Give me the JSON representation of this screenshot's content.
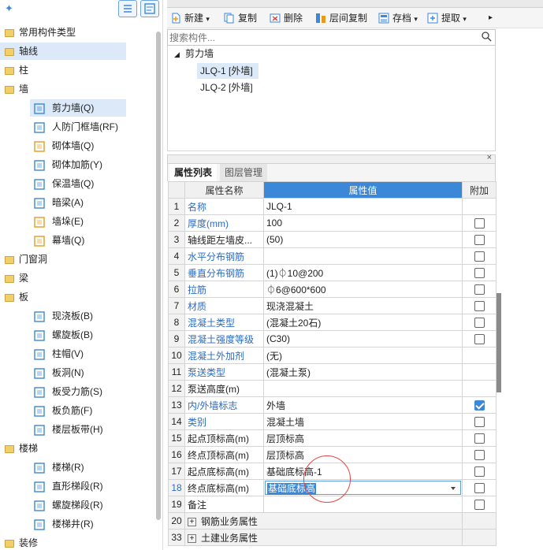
{
  "tree": {
    "items": [
      {
        "label": "常用构件类型",
        "level": 0,
        "icon": "folder-icon"
      },
      {
        "label": "轴线",
        "level": 0,
        "icon": "folder-icon",
        "selected": true
      },
      {
        "label": "柱",
        "level": 0,
        "icon": "folder-icon"
      },
      {
        "label": "墙",
        "level": 0,
        "icon": "folder-icon"
      },
      {
        "label": "剪力墙(Q)",
        "level": 1,
        "icon": "shear-wall-icon",
        "selected": true
      },
      {
        "label": "人防门框墙(RF)",
        "level": 1,
        "icon": "civil-defense-door-wall-icon"
      },
      {
        "label": "砌体墙(Q)",
        "level": 1,
        "icon": "masonry-wall-icon"
      },
      {
        "label": "砌体加筋(Y)",
        "level": 1,
        "icon": "masonry-rebar-icon"
      },
      {
        "label": "保温墙(Q)",
        "level": 1,
        "icon": "insulation-wall-icon"
      },
      {
        "label": "暗梁(A)",
        "level": 1,
        "icon": "hidden-beam-icon"
      },
      {
        "label": "墙垛(E)",
        "level": 1,
        "icon": "wall-pier-icon"
      },
      {
        "label": "幕墙(Q)",
        "level": 1,
        "icon": "curtain-wall-icon"
      },
      {
        "label": "门窗洞",
        "level": 0,
        "icon": "folder-icon"
      },
      {
        "label": "梁",
        "level": 0,
        "icon": "folder-icon"
      },
      {
        "label": "板",
        "level": 0,
        "icon": "folder-icon"
      },
      {
        "label": "现浇板(B)",
        "level": 1,
        "icon": "cast-slab-icon"
      },
      {
        "label": "螺旋板(B)",
        "level": 1,
        "icon": "spiral-slab-icon"
      },
      {
        "label": "柱帽(V)",
        "level": 1,
        "icon": "column-cap-icon"
      },
      {
        "label": "板洞(N)",
        "level": 1,
        "icon": "slab-hole-icon"
      },
      {
        "label": "板受力筋(S)",
        "level": 1,
        "icon": "slab-main-rebar-icon"
      },
      {
        "label": "板负筋(F)",
        "level": 1,
        "icon": "slab-negative-rebar-icon"
      },
      {
        "label": "楼层板带(H)",
        "level": 1,
        "icon": "floor-strip-icon"
      },
      {
        "label": "楼梯",
        "level": 0,
        "icon": "folder-icon"
      },
      {
        "label": "楼梯(R)",
        "level": 1,
        "icon": "stair-icon"
      },
      {
        "label": "直形梯段(R)",
        "level": 1,
        "icon": "straight-flight-icon"
      },
      {
        "label": "螺旋梯段(R)",
        "level": 1,
        "icon": "spiral-flight-icon"
      },
      {
        "label": "楼梯井(R)",
        "level": 1,
        "icon": "stairwell-icon"
      },
      {
        "label": "装修",
        "level": 0,
        "icon": "folder-icon"
      }
    ]
  },
  "toolbar": {
    "new_label": "新建",
    "copy_label": "复制",
    "delete_label": "删除",
    "layer_copy_label": "层间复制",
    "save_label": "存档",
    "extract_label": "提取"
  },
  "search": {
    "placeholder": "搜索构件..."
  },
  "components": {
    "group": "剪力墙",
    "items": [
      {
        "label": "JLQ-1 [外墙]",
        "selected": true
      },
      {
        "label": "JLQ-2 [外墙]",
        "selected": false
      }
    ]
  },
  "props": {
    "tabs": [
      "属性列表",
      "图层管理"
    ],
    "headers": {
      "name": "属性名称",
      "value": "属性值",
      "extra": "附加"
    },
    "rows": [
      {
        "no": "1",
        "name": "名称",
        "value": "JLQ-1",
        "blue": true,
        "check": null
      },
      {
        "no": "2",
        "name": "厚度(mm)",
        "value": "100",
        "blue": true,
        "check": false
      },
      {
        "no": "3",
        "name": "轴线距左墙皮...",
        "value": "(50)",
        "blue": false,
        "check": false
      },
      {
        "no": "4",
        "name": "水平分布钢筋",
        "value": "",
        "blue": true,
        "check": false
      },
      {
        "no": "5",
        "name": "垂直分布钢筋",
        "value": "(1)⏀10@200",
        "blue": true,
        "check": false
      },
      {
        "no": "6",
        "name": "拉筋",
        "value": "⏀6@600*600",
        "blue": true,
        "check": false
      },
      {
        "no": "7",
        "name": "材质",
        "value": "现浇混凝土",
        "blue": true,
        "check": false
      },
      {
        "no": "8",
        "name": "混凝土类型",
        "value": "(混凝土20石)",
        "blue": true,
        "check": false
      },
      {
        "no": "9",
        "name": "混凝土强度等级",
        "value": "(C30)",
        "blue": true,
        "check": false
      },
      {
        "no": "10",
        "name": "混凝土外加剂",
        "value": "(无)",
        "blue": true,
        "check": null
      },
      {
        "no": "11",
        "name": "泵送类型",
        "value": "(混凝土泵)",
        "blue": true,
        "check": null
      },
      {
        "no": "12",
        "name": "泵送高度(m)",
        "value": "",
        "blue": false,
        "check": null
      },
      {
        "no": "13",
        "name": "内/外墙标志",
        "value": "外墙",
        "blue": true,
        "check": true
      },
      {
        "no": "14",
        "name": "类别",
        "value": "混凝土墙",
        "blue": true,
        "check": false
      },
      {
        "no": "15",
        "name": "起点顶标高(m)",
        "value": "层顶标高",
        "blue": false,
        "check": false
      },
      {
        "no": "16",
        "name": "终点顶标高(m)",
        "value": "层顶标高",
        "blue": false,
        "check": false
      },
      {
        "no": "17",
        "name": "起点底标高(m)",
        "value": "基础底标高-1",
        "blue": false,
        "check": false
      },
      {
        "no": "18",
        "name": "终点底标高(m)",
        "value": "基础底标高",
        "blue": false,
        "check": false,
        "editing": true
      },
      {
        "no": "19",
        "name": "备注",
        "value": "",
        "blue": false,
        "check": false
      }
    ],
    "groups": [
      {
        "no": "20",
        "label": "钢筋业务属性"
      },
      {
        "no": "33",
        "label": "土建业务属性"
      }
    ]
  }
}
